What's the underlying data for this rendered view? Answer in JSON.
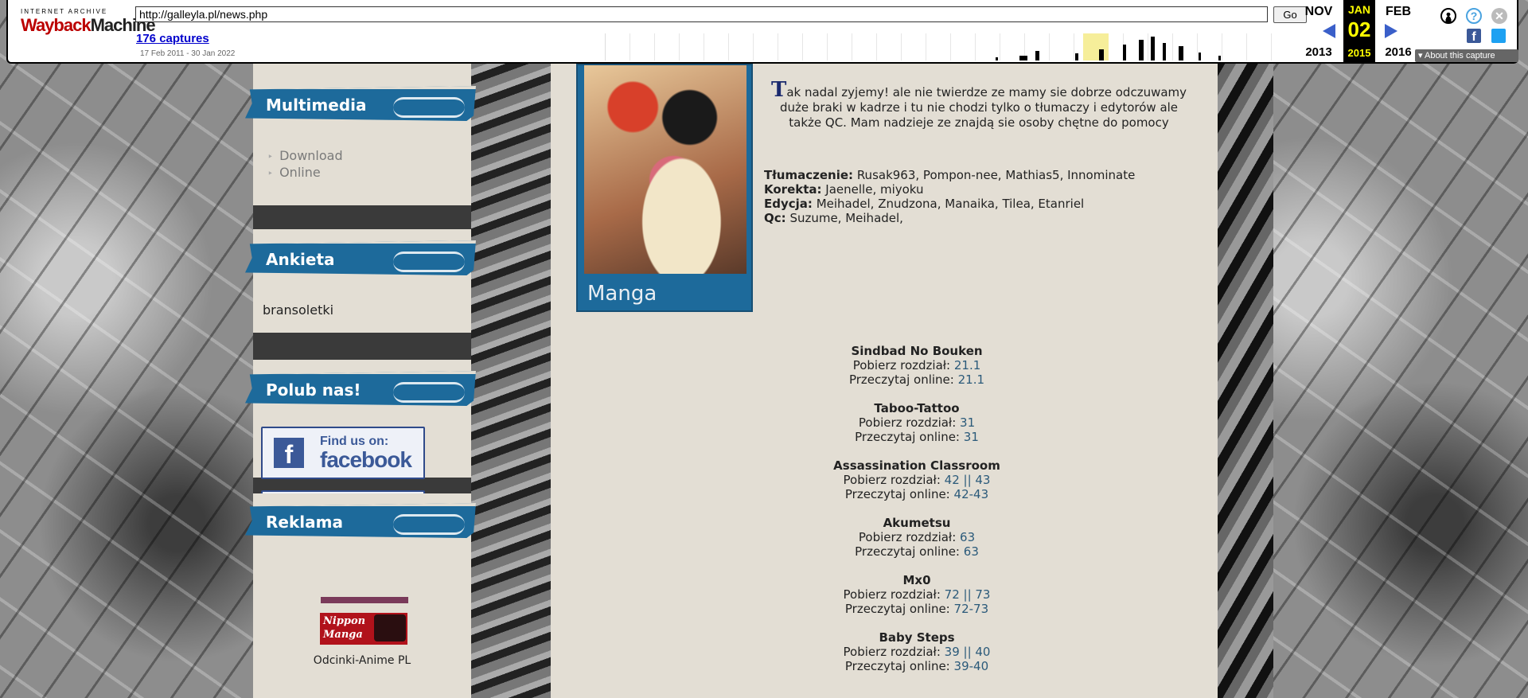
{
  "wayback": {
    "logo_top": "INTERNET ARCHIVE",
    "logo_main_a": "Wayback",
    "logo_main_b": "Machine",
    "url": "http://galleyla.pl/news.php",
    "go_label": "Go",
    "captures": "176 captures",
    "range": "17 Feb 2011 - 30 Jan 2022",
    "prev_month": "NOV",
    "prev_year": "2013",
    "cur_month": "JAN",
    "cur_day": "02",
    "cur_year": "2015",
    "next_month": "FEB",
    "next_year": "2016",
    "about": "About this capture"
  },
  "sidebar": {
    "multimedia": {
      "title": "Multimedia",
      "items": [
        "Download",
        "Online"
      ]
    },
    "poll": {
      "title": "Ankieta",
      "text": "bransoletki"
    },
    "like": {
      "title": "Polub nas!",
      "fb_line1": "Find us on:",
      "fb_line2": "facebook",
      "fb_icon": "f"
    },
    "ads": {
      "title": "Reklama",
      "banner": "Nippon Manga",
      "link": "Odcinki-Anime PL"
    }
  },
  "content": {
    "image_label": "Manga",
    "intro_drop": "T",
    "intro": "ak nadal zyjemy! ale nie twierdze ze mamy sie dobrze odczuwamy duże braki w kadrze i tu nie chodzi tylko o tłumaczy i edytorów ale także QC. Mam nadzieje ze znajdą sie osoby chętne do pomocy",
    "credits": [
      {
        "label": "Tłumaczenie:",
        "value": "Rusak963, Pompon-nee, Mathias5, Innominate"
      },
      {
        "label": "Korekta:",
        "value": "Jaenelle, miyoku"
      },
      {
        "label": "Edycja:",
        "value": "Meihadel, Znudzona, Manaika, Tilea, Etanriel"
      },
      {
        "label": "Qc:",
        "value": "Suzume, Meihadel,"
      }
    ],
    "download_label": "Pobierz rozdział:",
    "online_label": "Przeczytaj online:",
    "series": [
      {
        "title": "Sindbad No Bouken",
        "download": "21.1",
        "online": "21.1"
      },
      {
        "title": "Taboo-Tattoo",
        "download": "31",
        "online": "31"
      },
      {
        "title": "Assassination Classroom",
        "download": "42 || 43",
        "online": "42-43"
      },
      {
        "title": "Akumetsu",
        "download": "63",
        "online": "63"
      },
      {
        "title": "Mx0",
        "download": "72 || 73",
        "online": "72-73"
      },
      {
        "title": "Baby Steps",
        "download": "39 || 40",
        "online": "39-40"
      }
    ]
  },
  "colors": {
    "accent": "#1d6a9b",
    "panel": "#e3ded4",
    "link": "#2b5a7a"
  }
}
